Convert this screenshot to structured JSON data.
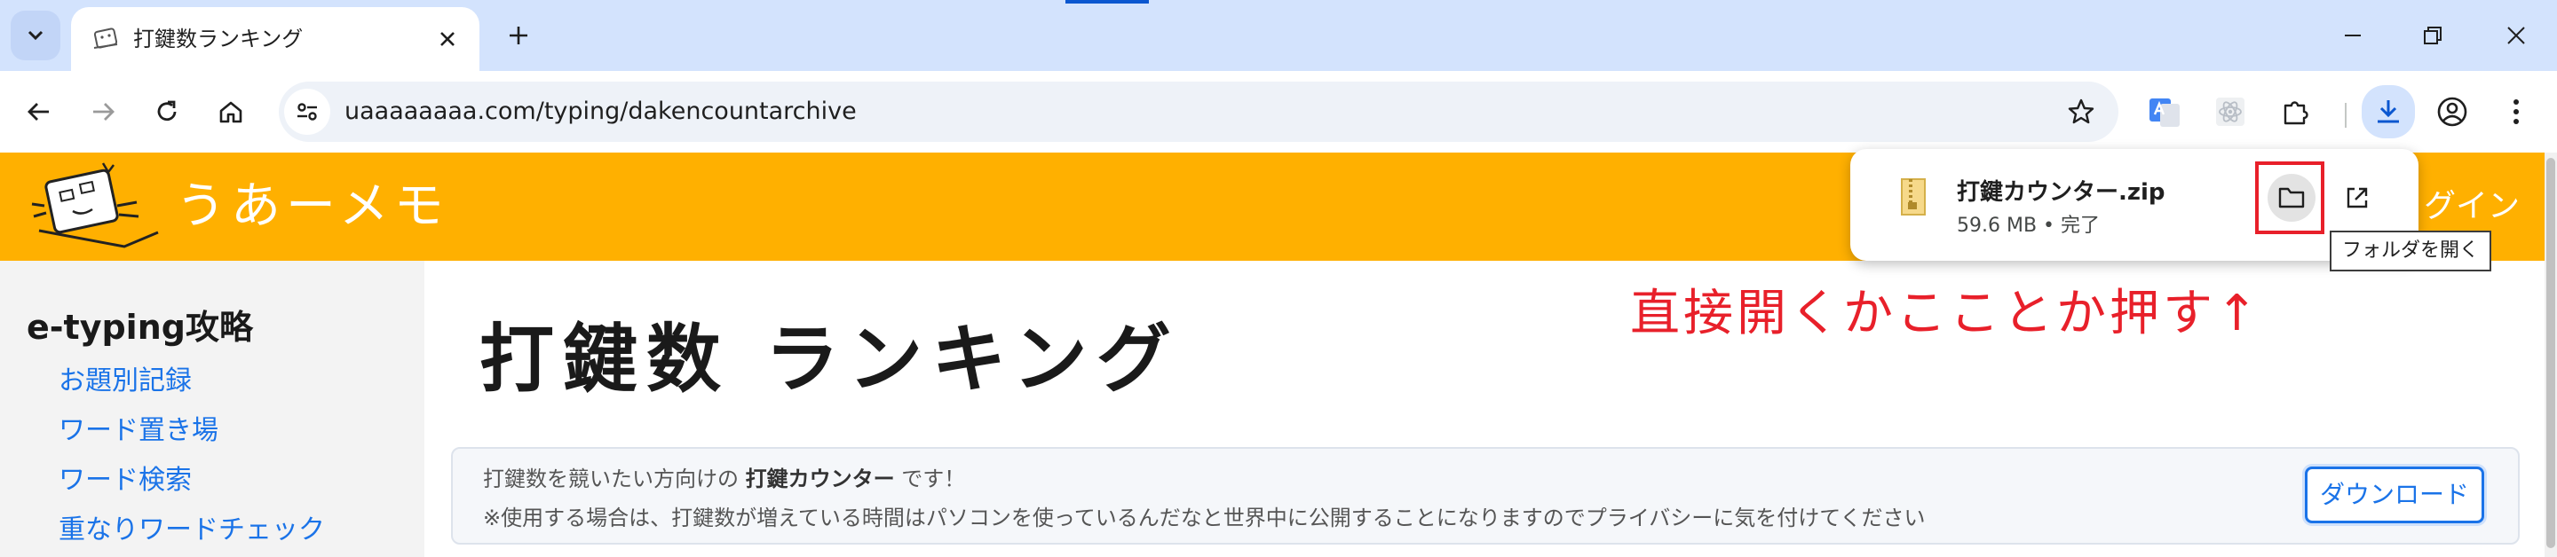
{
  "browser": {
    "tab": {
      "title": "打鍵数ランキング"
    },
    "address": {
      "url": "uaaaaaaaa.com/typing/dakencountarchive"
    }
  },
  "site": {
    "title": "うあーメモ",
    "login_text": "グイン"
  },
  "sidebar": {
    "heading": "e-typing攻略",
    "items": [
      {
        "label": "お題別記録"
      },
      {
        "label": "ワード置き場"
      },
      {
        "label": "ワード検索"
      },
      {
        "label": "重なりワードチェック"
      }
    ]
  },
  "main": {
    "heading": "打鍵数 ランキング",
    "annotation": "直接開くかこことか押す↑",
    "info": {
      "line1_prefix": "打鍵数を競いたい方向けの",
      "line1_bold": "打鍵カウンター",
      "line1_suffix": "です！",
      "line2": "※使用する場合は、打鍵数が増えている時間はパソコンを使っているんだなと世界中に公開することになりますのでプライバシーに気を付けてください",
      "download_button": "ダウンロード"
    }
  },
  "download_bubble": {
    "filename": "打鍵カウンター.zip",
    "status": "59.6 MB • 完了",
    "tooltip": "フォルダを開く"
  },
  "colors": {
    "header_bg": "#ffb000",
    "annotation_red": "#e8202a",
    "link_blue": "#1a73e8",
    "tabstrip": "#d3e3fd"
  }
}
